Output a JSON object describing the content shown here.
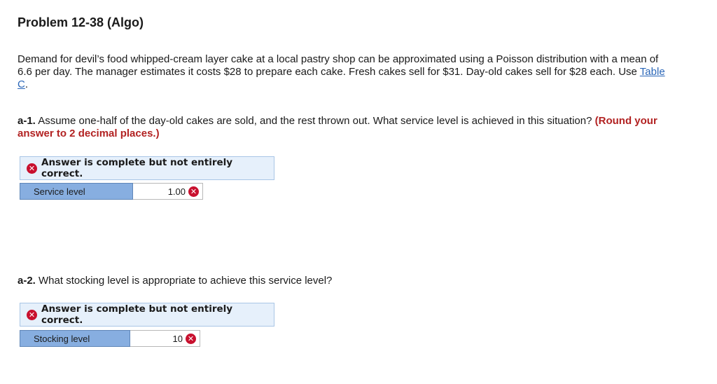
{
  "problem": {
    "title": "Problem 12-38 (Algo)",
    "intro_text": "Demand for devil’s food whipped-cream layer cake at a local pastry shop can be approximated using a Poisson distribution with a mean of 6.6 per day. The manager estimates it costs $28 to prepare each cake. Fresh cakes sell for $31. Day-old cakes sell for $28 each. Use ",
    "table_link": "Table C",
    "intro_end": "."
  },
  "part_a1": {
    "number": "a-1.",
    "question": " Assume one-half of the day-old cakes are sold, and the rest thrown out. What service level is achieved in this situation? ",
    "hint": "(Round your answer to 2 decimal places.)",
    "status": "Answer is complete but not entirely correct.",
    "answer_label": "Service level",
    "answer_value": "1.00"
  },
  "part_a2": {
    "number": "a-2.",
    "question": " What stocking level is appropriate to achieve this service level?",
    "status": "Answer is complete but not entirely correct.",
    "answer_label": "Stocking level",
    "answer_value": "10"
  },
  "icons": {
    "incorrect": "x-circle-icon",
    "incorrect_color": "#c8102e"
  },
  "colors": {
    "link": "#2a66b8",
    "hint": "#b22222",
    "status_bg": "#e6f0fb",
    "label_bg": "#87aee0"
  }
}
